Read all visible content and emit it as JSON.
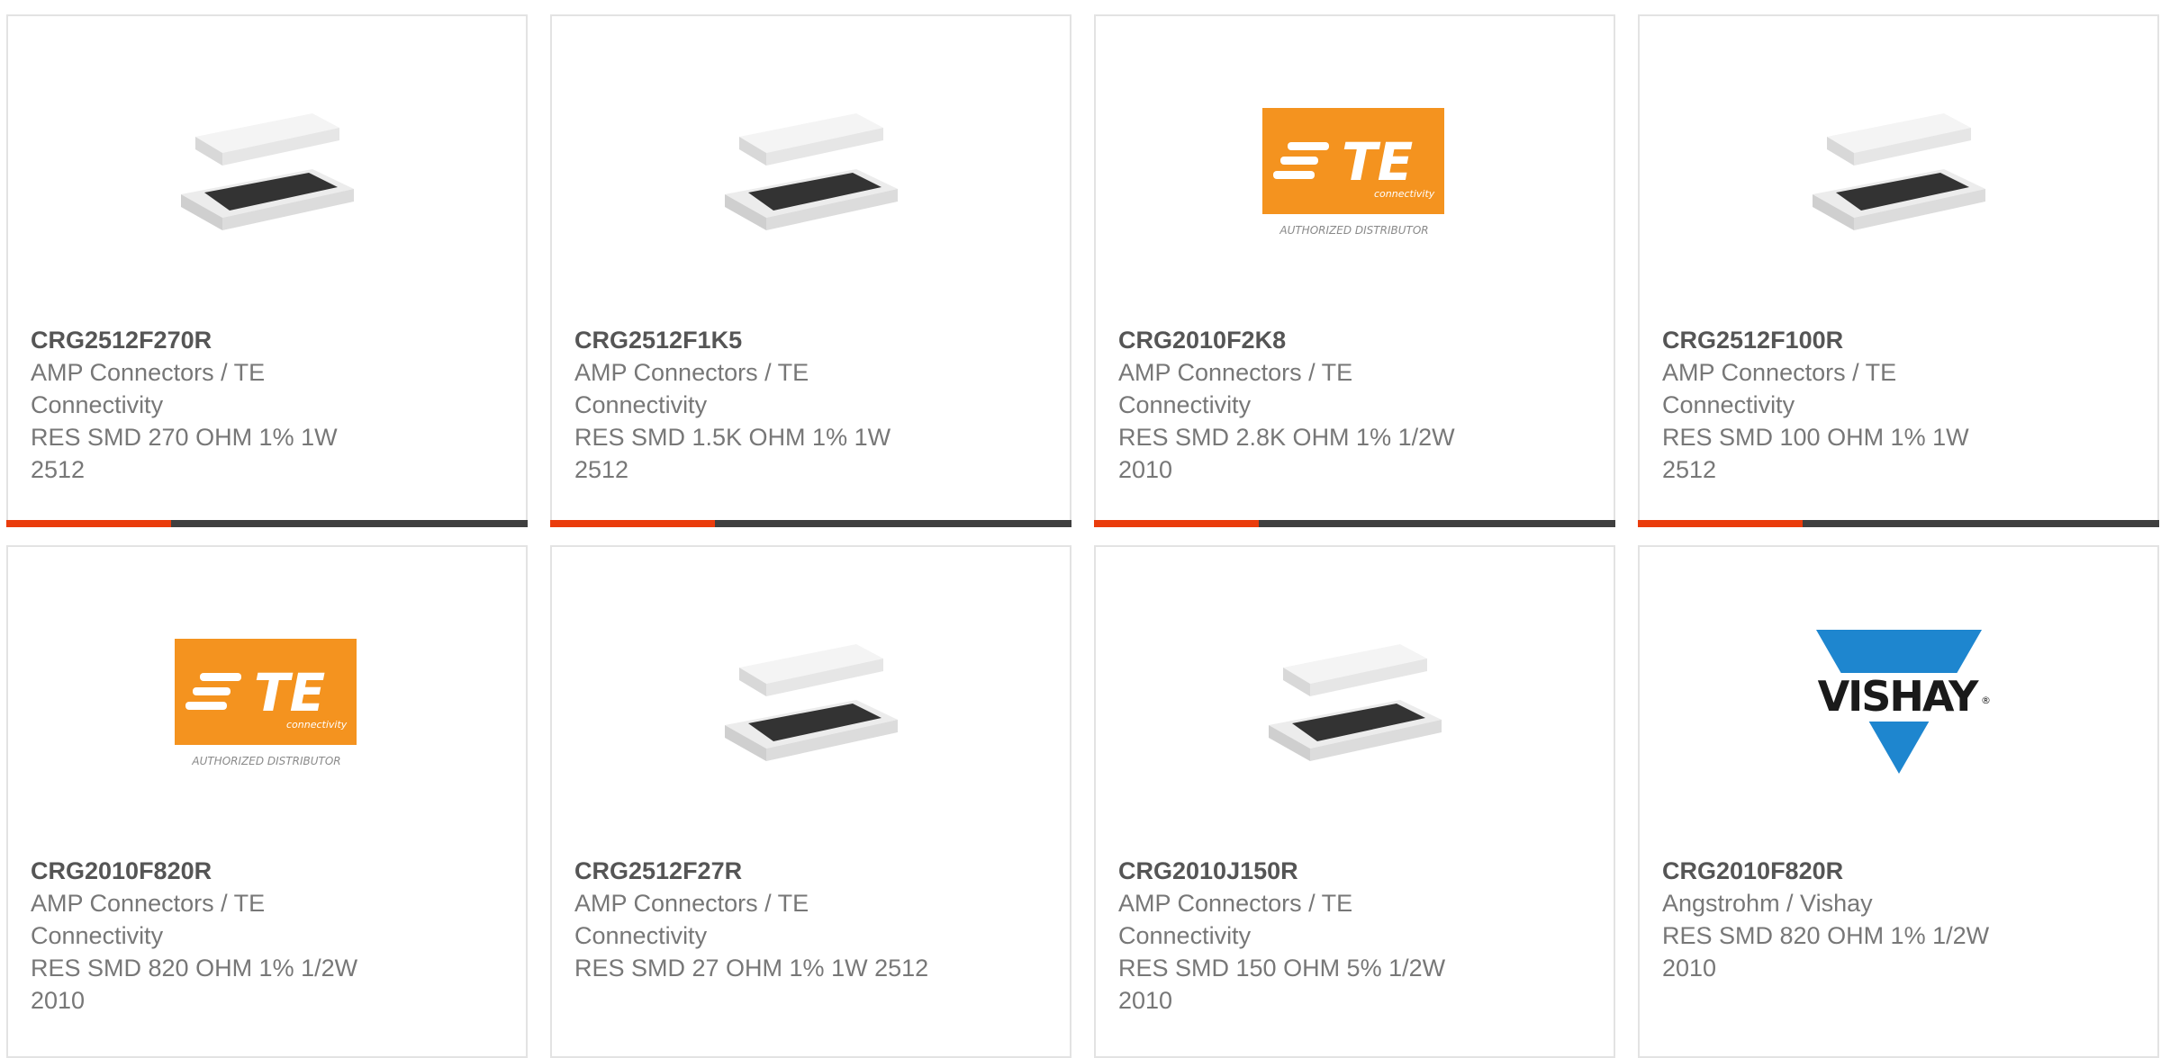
{
  "colors": {
    "accent": "#ea3c0c",
    "bar": "#3f3f3f",
    "te_orange": "#f4931f",
    "vishay_blue": "#1e86cf"
  },
  "products": [
    {
      "part_number": "CRG2512F270R",
      "manufacturer": "AMP Connectors / TE Connectivity",
      "description": "RES SMD 270 OHM 1% 1W 2512",
      "image": "resistor-chip-icon"
    },
    {
      "part_number": "CRG2512F1K5",
      "manufacturer": "AMP Connectors / TE Connectivity",
      "description": "RES SMD 1.5K OHM 1% 1W 2512",
      "image": "resistor-chip-icon"
    },
    {
      "part_number": "CRG2010F2K8",
      "manufacturer": "AMP Connectors / TE Connectivity",
      "description": "RES SMD 2.8K OHM 1% 1/2W 2010",
      "image": "te-logo",
      "logo_text": "TE",
      "logo_subtext": "connectivity",
      "logo_caption": "AUTHORIZED DISTRIBUTOR"
    },
    {
      "part_number": "CRG2512F100R",
      "manufacturer": "AMP Connectors / TE Connectivity",
      "description": "RES SMD 100 OHM 1% 1W 2512",
      "image": "resistor-chip-icon"
    },
    {
      "part_number": "CRG2010F820R",
      "manufacturer": "AMP Connectors / TE Connectivity",
      "description": "RES SMD 820 OHM 1% 1/2W 2010",
      "image": "te-logo",
      "logo_text": "TE",
      "logo_subtext": "connectivity",
      "logo_caption": "AUTHORIZED DISTRIBUTOR"
    },
    {
      "part_number": "CRG2512F27R",
      "manufacturer": "AMP Connectors / TE Connectivity",
      "description": "RES SMD 27 OHM 1% 1W 2512",
      "image": "resistor-chip-icon"
    },
    {
      "part_number": "CRG2010J150R",
      "manufacturer": "AMP Connectors / TE Connectivity",
      "description": "RES SMD 150 OHM 5% 1/2W 2010",
      "image": "resistor-chip-icon"
    },
    {
      "part_number": "CRG2010F820R",
      "manufacturer": "Angstrohm / Vishay",
      "description": "RES SMD 820 OHM 1% 1/2W 2010",
      "image": "vishay-logo",
      "logo_text": "VISHAY",
      "logo_mark": "®"
    }
  ]
}
